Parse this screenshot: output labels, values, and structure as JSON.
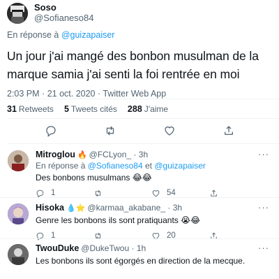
{
  "main_tweet": {
    "display_name": "Soso",
    "handle": "@Sofianeso84",
    "reply_prefix": "En réponse à",
    "reply_handle": "@guizapaiser",
    "text": "Un jour j'ai mangé des bonbon musulman de la marque samia j'ai senti la foi rentrée en moi",
    "time": "2:03 PM",
    "date": "21 oct. 2020",
    "client": "Twitter Web App",
    "dot": "·",
    "stats": {
      "retweets_count": "31",
      "retweets_label": "Retweets",
      "quotes_count": "5",
      "quotes_label": "Tweets cités",
      "likes_count": "288",
      "likes_label": "J'aime"
    }
  },
  "replies": [
    {
      "display_name": "Mitroglou",
      "emoji": "🔥",
      "handle": "@FCLyon_",
      "time": "3h",
      "dot": "·",
      "reply_prefix": "En réponse à",
      "reply_handles": [
        "@Sofianeso84",
        "@guizapaiser"
      ],
      "reply_joiner": "et",
      "text": "Des bonbons musulmans 😂😂",
      "reply_count": "1",
      "retweet_count": "",
      "like_count": "54"
    },
    {
      "display_name": "Hisoka",
      "emoji": "💧⭐",
      "handle": "@karmaa_akabane_",
      "time": "3h",
      "dot": "·",
      "text": "Genre les bonbons ils sont pratiquants 😭😂",
      "reply_count": "1",
      "retweet_count": "",
      "like_count": "20"
    },
    {
      "display_name": "TwouDuke",
      "emoji": "",
      "handle": "@DukeTwou",
      "time": "1h",
      "dot": "·",
      "text": "Les bonbons ils sont égorgés en direction de la mecque.",
      "reply_count": "",
      "retweet_count": "",
      "like_count": ""
    }
  ],
  "icons": {
    "more": "more-icon",
    "reply": "reply-icon",
    "retweet": "retweet-icon",
    "like": "heart-icon",
    "share": "share-icon"
  },
  "colors": {
    "accent": "#1d9bf0",
    "muted": "#536471",
    "text": "#0f1419",
    "divider": "#eff3f4"
  }
}
